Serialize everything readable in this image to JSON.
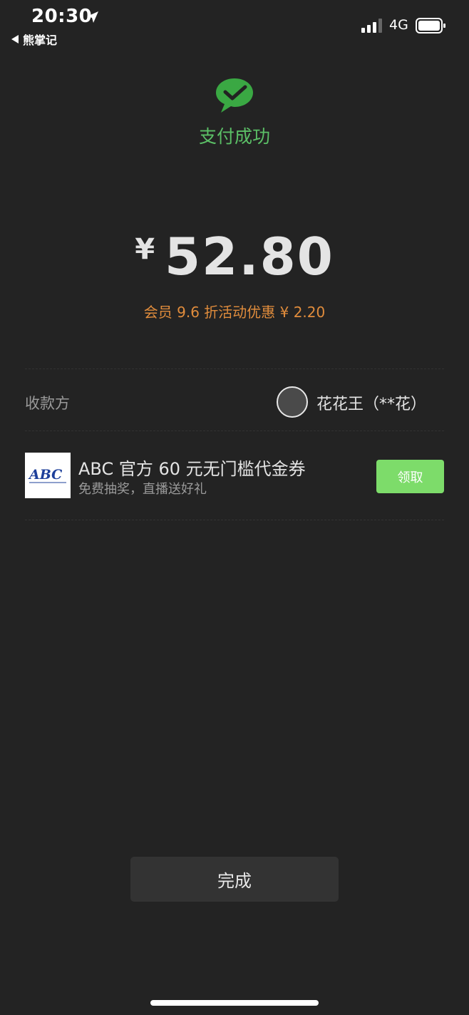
{
  "status_bar": {
    "time": "20:30",
    "back_app": "熊掌记",
    "network": "4G"
  },
  "header": {
    "title": "支付成功"
  },
  "payment": {
    "currency": "¥",
    "amount": "52.80",
    "discount_text": "会员 9.6 折活动优惠 ¥ 2.20"
  },
  "payee": {
    "label": "收款方",
    "name": "花花王（**花）"
  },
  "coupon": {
    "logo_text": "ABC",
    "title": "ABC 官方 60 元无门槛代金券",
    "subtitle": "免费抽奖，直播送好礼",
    "claim_label": "领取"
  },
  "footer": {
    "done_label": "完成"
  },
  "colors": {
    "background": "#232323",
    "success_green": "#5bbf66",
    "discount_orange": "#e08c3c",
    "claim_green": "#7ddc6a",
    "done_bg": "#333333"
  }
}
